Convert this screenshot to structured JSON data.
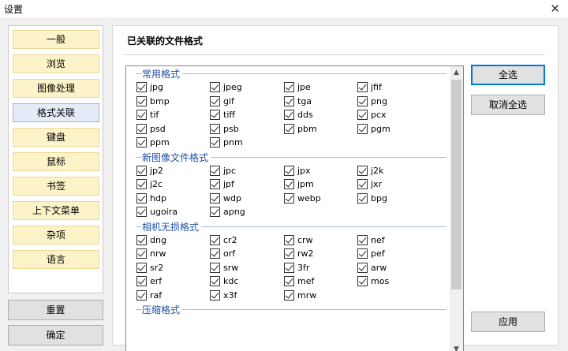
{
  "window": {
    "title": "设置",
    "close_glyph": "✕"
  },
  "sidebar": {
    "items": [
      {
        "label": "一般",
        "key": "general"
      },
      {
        "label": "浏览",
        "key": "browse"
      },
      {
        "label": "图像处理",
        "key": "image-processing"
      },
      {
        "label": "格式关联",
        "key": "format-association",
        "active": true
      },
      {
        "label": "键盘",
        "key": "keyboard"
      },
      {
        "label": "鼠标",
        "key": "mouse"
      },
      {
        "label": "书签",
        "key": "bookmarks"
      },
      {
        "label": "上下文菜单",
        "key": "context-menu"
      },
      {
        "label": "杂项",
        "key": "misc"
      },
      {
        "label": "语言",
        "key": "language"
      }
    ],
    "reset_label": "重置",
    "ok_label": "确定"
  },
  "panel": {
    "title": "已关联的文件格式",
    "sections": [
      {
        "title": "常用格式",
        "formats": [
          "jpg",
          "jpeg",
          "jpe",
          "jfif",
          "bmp",
          "gif",
          "tga",
          "png",
          "tif",
          "tiff",
          "dds",
          "pcx",
          "psd",
          "psb",
          "pbm",
          "pgm",
          "ppm",
          "pnm"
        ]
      },
      {
        "title": "新图像文件格式",
        "formats": [
          "jp2",
          "jpc",
          "jpx",
          "j2k",
          "j2c",
          "jpf",
          "jpm",
          "jxr",
          "hdp",
          "wdp",
          "webp",
          "bpg",
          "ugoira",
          "apng"
        ]
      },
      {
        "title": "相机无损格式",
        "formats": [
          "dng",
          "cr2",
          "crw",
          "nef",
          "nrw",
          "orf",
          "rw2",
          "pef",
          "sr2",
          "srw",
          "3fr",
          "arw",
          "erf",
          "kdc",
          "mef",
          "mos",
          "raf",
          "x3f",
          "mrw"
        ]
      },
      {
        "title": "压缩格式",
        "formats": []
      }
    ]
  },
  "actions": {
    "select_all_label": "全选",
    "deselect_all_label": "取消全选",
    "apply_label": "应用"
  },
  "colors": {
    "nav_bg": "#fdf3c9",
    "nav_active_bg": "#e5ebf7",
    "section_title": "#1f4fa6",
    "focus": "#0078d7"
  }
}
